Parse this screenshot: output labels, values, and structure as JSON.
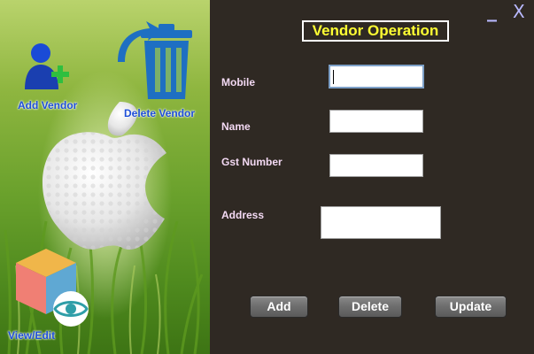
{
  "sidebar": {
    "add_vendor_label": "Add Vendor",
    "delete_vendor_label": "Delete Vendor",
    "view_edit_label": "View/Edit"
  },
  "window": {
    "minimize_label": "_",
    "close_label": "X"
  },
  "form": {
    "title": "Vendor Operation",
    "mobile_label": "Mobile",
    "mobile_value": "",
    "name_label": "Name",
    "name_value": "",
    "gst_label": "Gst Number",
    "gst_value": "",
    "address_label": "Address",
    "address_value": ""
  },
  "actions": {
    "add_label": "Add",
    "delete_label": "Delete",
    "update_label": "Update"
  },
  "colors": {
    "panel_bg": "#2f2923",
    "title_text": "#ffff33",
    "label_text": "#f3d9f3",
    "nav_label": "#1f4fd8"
  }
}
